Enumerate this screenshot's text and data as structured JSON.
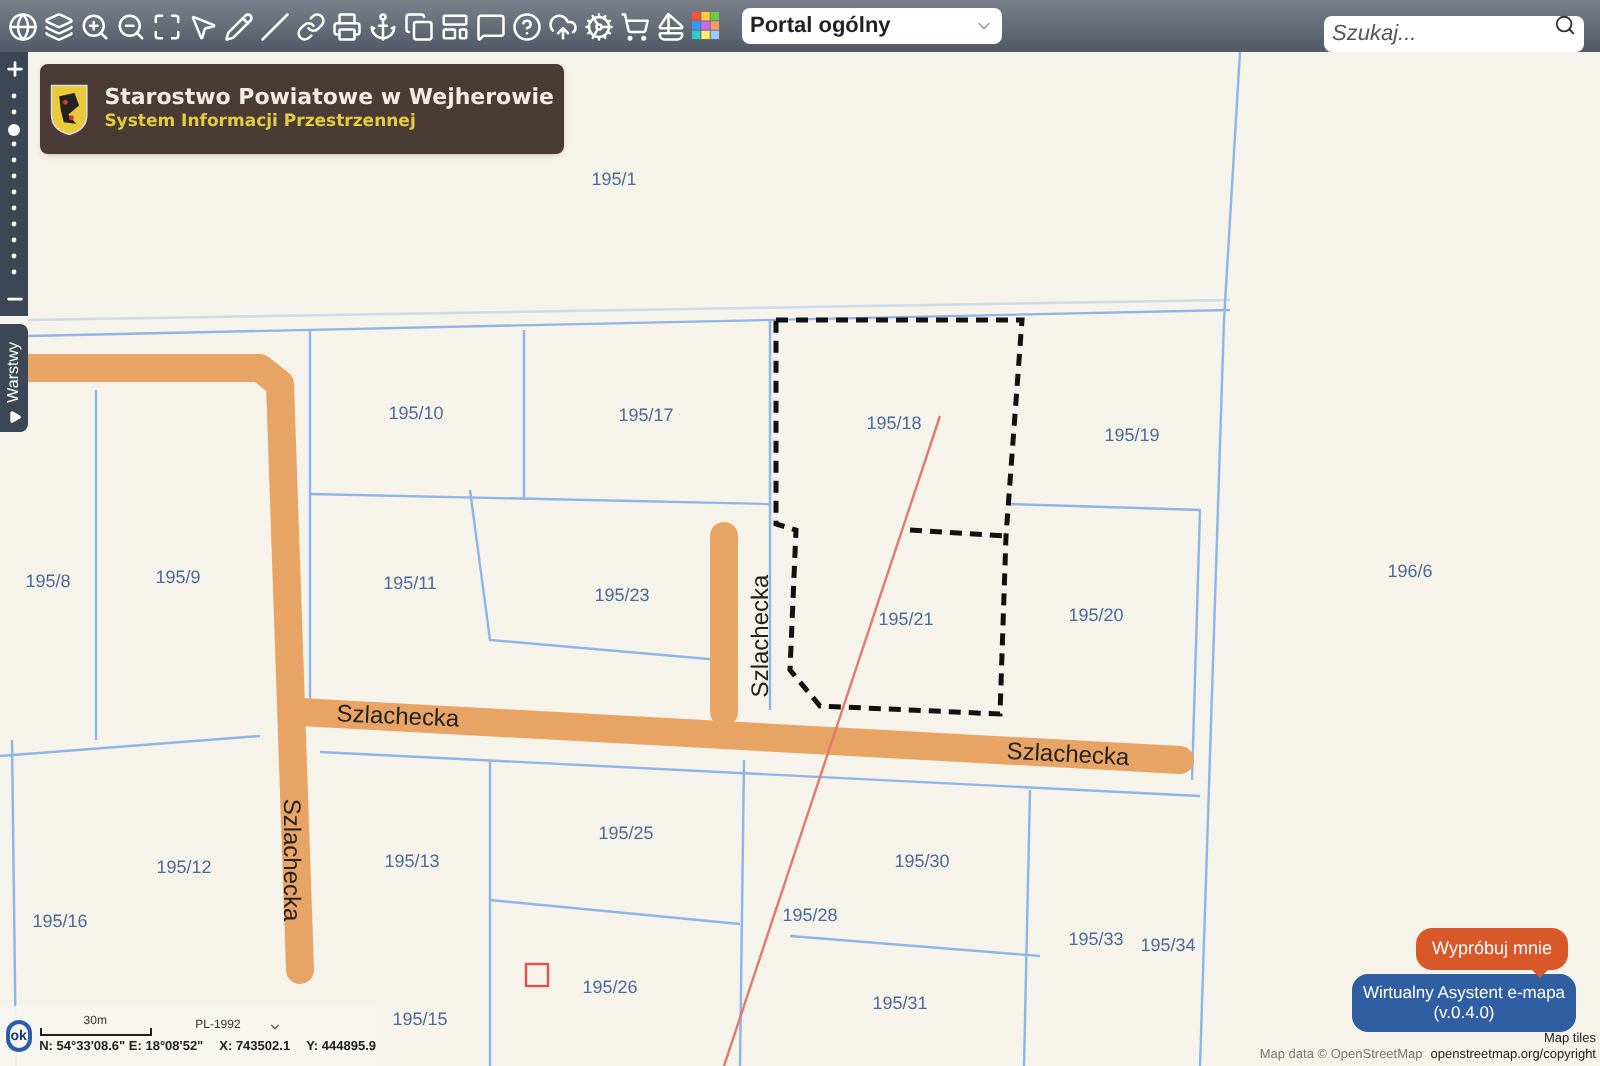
{
  "toolbar": {
    "portal_select": "Portal ogólny",
    "search": {
      "placeholder": "Szukaj..."
    }
  },
  "header": {
    "title": "Starostwo Powiatowe w Wejherowie",
    "subtitle": "System Informacji Przestrzennej"
  },
  "zoom_slider": {
    "level": 0.8
  },
  "layers_tab": "Warstwy",
  "map": {
    "parcels": [
      "195/1",
      "195/10",
      "195/17",
      "195/18",
      "195/19",
      "195/8",
      "195/9",
      "195/11",
      "195/23",
      "195/21",
      "195/20",
      "196/6",
      "195/25",
      "195/13",
      "195/12",
      "195/30",
      "195/28",
      "195/16",
      "195/33",
      "195/34",
      "195/26",
      "195/31",
      "195/15"
    ],
    "streets": [
      {
        "name": "Szlachecka",
        "kind": "horizontal"
      },
      {
        "name": "Szlachecka",
        "kind": "horizontal"
      },
      {
        "name": "Szlachecka",
        "kind": "vertical-up"
      },
      {
        "name": "Szlachecka",
        "kind": "vertical-down"
      }
    ]
  },
  "status": {
    "ok_button": "ok",
    "scale": "30m",
    "crs": "PL-1992",
    "geo": "N: 54°33'08.6\" E: 18°08'52\"",
    "x": "X: 743502.1",
    "y": "Y: 444895.9"
  },
  "assistant": {
    "try_me": "Wypróbuj mnie",
    "button": "Wirtualny Asystent e-mapa",
    "version": "(v.0.4.0)"
  },
  "attribution": {
    "tiles": "Map tiles",
    "data": "Map data © OpenStreetMap",
    "link": "openstreetmap.org/copyright"
  }
}
